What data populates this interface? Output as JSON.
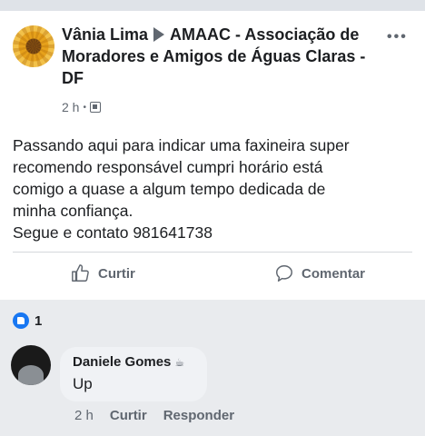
{
  "post": {
    "author": "Vânia Lima",
    "group": "AMAAC - Associação de Moradores e Amigos de Águas Claras - DF",
    "time": "2 h",
    "separator": "•",
    "more_label": "•••",
    "text_lines": [
      "Passando aqui para indicar uma faxineira super",
      "recomendo responsável cumpri horário está",
      "comigo a quase a algum tempo dedicada de",
      "minha confiança.",
      "Segue e contato 981641738"
    ],
    "actions": {
      "like_label": "Curtir",
      "comment_label": "Comentar"
    },
    "reaction_count": "1"
  },
  "comment": {
    "author": "Daniele Gomes",
    "author_icon": "coffee-icon",
    "text": "Up",
    "time": "2 h",
    "like_label": "Curtir",
    "reply_label": "Responder"
  },
  "colors": {
    "accent": "#1877f2",
    "text_primary": "#1c1e21",
    "text_secondary": "#606770",
    "bubble": "#f0f2f5"
  }
}
